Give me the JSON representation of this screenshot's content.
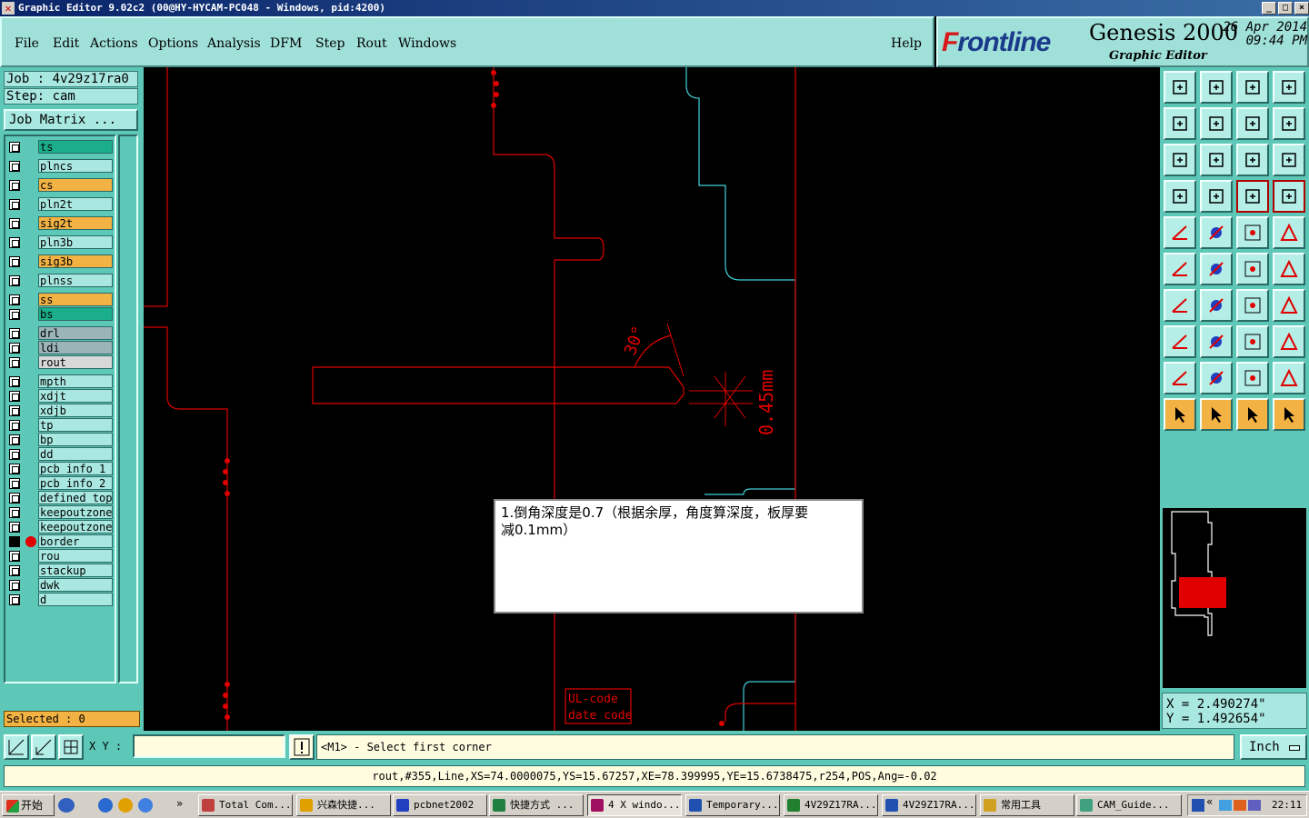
{
  "window": {
    "title": "Graphic Editor 9.02c2 (00@HY-HYCAM-PC048 - Windows, pid:4200)",
    "min": "_",
    "max": "□",
    "close": "×"
  },
  "menu": {
    "items": [
      {
        "label": "File"
      },
      {
        "label": "Edit"
      },
      {
        "label": "Actions"
      },
      {
        "label": "Options"
      },
      {
        "label": "Analysis"
      },
      {
        "label": "DFM"
      },
      {
        "label": "Step"
      },
      {
        "label": "Rout"
      },
      {
        "label": "Windows"
      }
    ],
    "help": "Help"
  },
  "brand": {
    "logo_prefix": "F",
    "logo_rest": "rontline",
    "product": "Genesis 2000",
    "subtitle": "Graphic Editor",
    "date": "26 Apr 2014",
    "time": "09:44 PM"
  },
  "job": {
    "job": "Job : 4v29z17ra0",
    "step": "Step: cam",
    "matrix_button": "Job Matrix ..."
  },
  "layers": [
    {
      "name": "ts",
      "color": "#1aaf8a"
    },
    {
      "name": "plncs",
      "color": "#a8e8e0"
    },
    {
      "name": "cs",
      "color": "#f2b244"
    },
    {
      "name": "pln2t",
      "color": "#a8e8e0"
    },
    {
      "name": "sig2t",
      "color": "#f2b244"
    },
    {
      "name": "pln3b",
      "color": "#a8e8e0"
    },
    {
      "name": "sig3b",
      "color": "#f2b244"
    },
    {
      "name": "plnss",
      "color": "#a8e8e0"
    },
    {
      "name": "ss",
      "color": "#f2b244"
    },
    {
      "name": "bs",
      "color": "#1aaf8a"
    },
    {
      "name": "drl",
      "color": "#9ab4b8"
    },
    {
      "name": "ldi",
      "color": "#9ab4b8"
    },
    {
      "name": "rout",
      "color": "#d8d8d8"
    },
    {
      "name": "mpth",
      "color": "#a8e8e0"
    },
    {
      "name": "xdjt",
      "color": "#a8e8e0"
    },
    {
      "name": "xdjb",
      "color": "#a8e8e0"
    },
    {
      "name": "tp",
      "color": "#a8e8e0"
    },
    {
      "name": "bp",
      "color": "#a8e8e0"
    },
    {
      "name": "dd",
      "color": "#a8e8e0"
    },
    {
      "name": "pcb_info_1",
      "color": "#a8e8e0"
    },
    {
      "name": "pcb_info_2",
      "color": "#a8e8e0"
    },
    {
      "name": "defined_top",
      "color": "#a8e8e0"
    },
    {
      "name": "keepoutzone",
      "color": "#a8e8e0"
    },
    {
      "name": "keepoutzone",
      "color": "#a8e8e0"
    },
    {
      "name": "border",
      "color": "#a8e8e0",
      "active": true
    },
    {
      "name": "rou",
      "color": "#a8e8e0"
    },
    {
      "name": "stackup",
      "color": "#a8e8e0"
    },
    {
      "name": "dwk",
      "color": "#a8e8e0"
    },
    {
      "name": "d",
      "color": "#a8e8e0"
    }
  ],
  "selected": "Selected : 0",
  "canvas": {
    "dimension_text": "0.45mm",
    "angle_text": "30°",
    "ul_code": "UL-code",
    "date_code": "date code"
  },
  "note": {
    "line1": "1.倒角深度是0.7（根据余厚，角度算深度，板厚要",
    "line2": "减0.1mm）"
  },
  "coords": {
    "x": "X = 2.490274\"",
    "y": "Y = 1.492654\""
  },
  "command": {
    "xy_label": "X Y :",
    "xy_value": "",
    "prompt": "<M1> - Select first corner",
    "unit": "Inch"
  },
  "status": "rout,#355,Line,XS=74.0000075,YS=15.67257,XE=78.399995,YE=15.6738475,r254,POS,Ang=-0.02",
  "taskbar": {
    "start": "开始",
    "items": [
      {
        "label": "Total Com...",
        "color": "#c04040"
      },
      {
        "label": "兴森快捷...",
        "color": "#e0a000"
      },
      {
        "label": "pcbnet2002",
        "color": "#2040c0"
      },
      {
        "label": "快捷方式 ...",
        "color": "#208040"
      },
      {
        "label": "4 X windo...",
        "color": "#a01060",
        "pressed": true
      },
      {
        "label": "Temporary...",
        "color": "#2050b0"
      },
      {
        "label": "4V29Z17RA...",
        "color": "#208030"
      },
      {
        "label": "4V29Z17RA...",
        "color": "#2050b0"
      },
      {
        "label": "常用工具",
        "color": "#d0a020"
      },
      {
        "label": "CAM_Guide...",
        "color": "#40a080"
      }
    ],
    "clock": "22:11"
  }
}
